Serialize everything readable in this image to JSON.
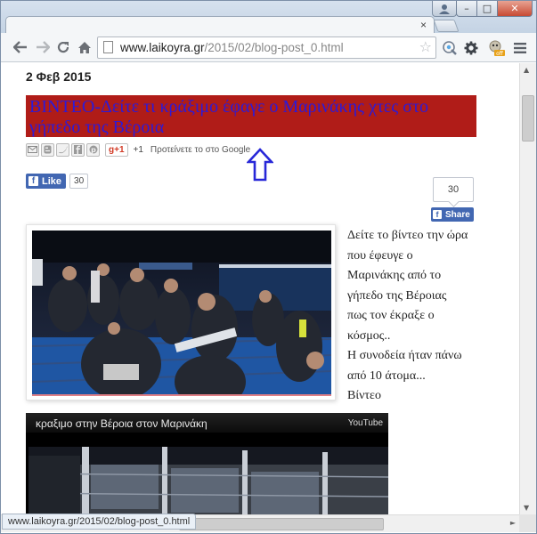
{
  "browser": {
    "tab_close": "×",
    "url_host": "www.laikoyra.gr",
    "url_path": "/2015/02/blog-post_0.html",
    "window_buttons": {
      "minimize": "–",
      "maximize": "□",
      "close": "✕"
    },
    "status_url": "www.laikoyra.gr/2015/02/blog-post_0.html",
    "icons": [
      "back-icon",
      "forward-icon",
      "reload-icon",
      "home-icon",
      "page-icon",
      "star-icon",
      "translate-icon",
      "settings-gear-icon",
      "extension-badge-icon",
      "menu-icon"
    ]
  },
  "post": {
    "date": "2 Φεβ 2015",
    "title": "ΒΙΝΤΕΟ-Δείτε τι κράξιμο έφαγε ο Μαρινάκης χτες στο γήπεδο της Βέροια",
    "share": {
      "icons": [
        "email-icon",
        "blogger-icon",
        "twitter-icon",
        "facebook-icon",
        "pinterest-icon"
      ],
      "gplus_label": "g+1",
      "plus_count": "+1",
      "recommend_text": "Προτείνετε το στο Google"
    },
    "facebook": {
      "like_label": "Like",
      "like_count": "30",
      "share_count": "30",
      "share_label": "Share"
    },
    "body_lines": [
      "Δείτε το βίντεο την ώρα",
      "που έφευγε ο",
      "Μαρινάκης από το",
      "γήπεδο της Βέροιας",
      "πως τον έκραξε ο",
      "κόσμος..",
      "Η συνοδεία ήταν πάνω",
      "από 10 άτομα...",
      "Βίντεο"
    ],
    "video": {
      "title": "κραξιμο στην Βέροια στον Μαρινάκη",
      "source": "YouTube"
    }
  },
  "accent_colors": {
    "title_background": "#b01c18",
    "title_text": "#2c1ad8",
    "facebook_blue": "#4267b2",
    "annotation_arrow": "#2727d8"
  }
}
